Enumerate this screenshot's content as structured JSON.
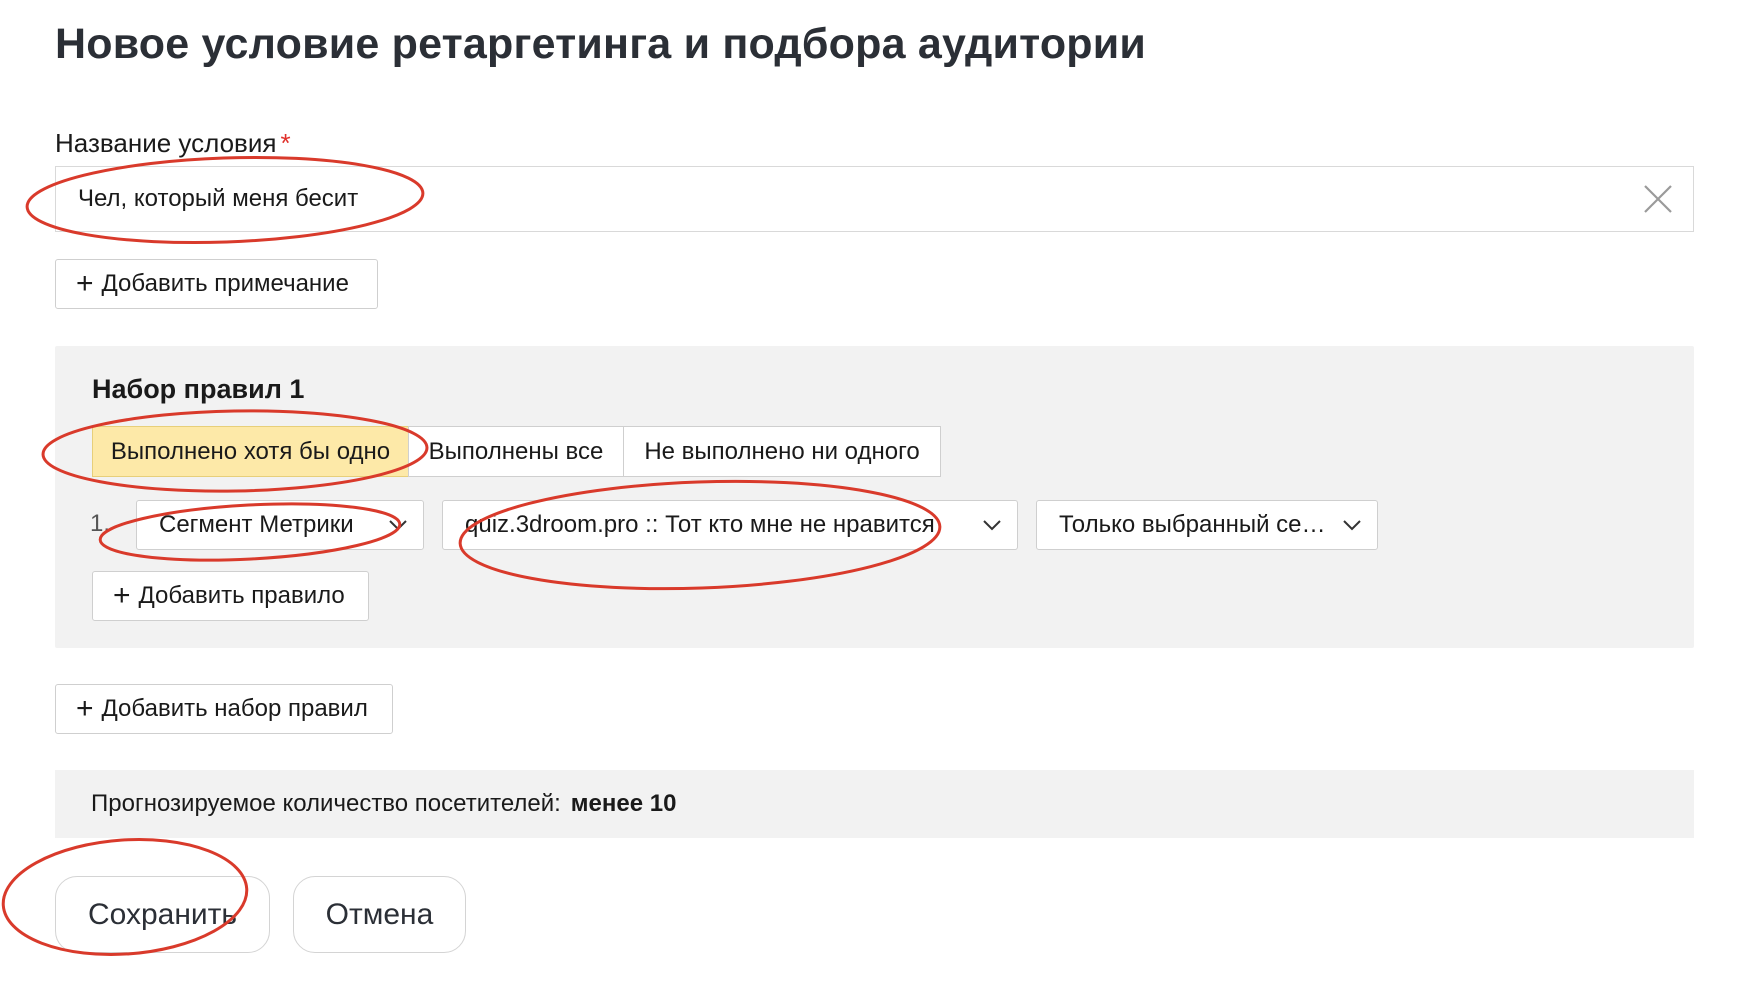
{
  "page": {
    "title": "Новое условие ретаргетинга и подбора аудитории"
  },
  "condition_name": {
    "label": "Название условия",
    "required_mark": "*",
    "value": "Чел, который меня бесит",
    "clear_icon": "close-icon"
  },
  "add_note_button": {
    "icon": "plus-icon",
    "label": "Добавить примечание"
  },
  "ruleset": {
    "title": "Набор правил 1",
    "modes": [
      {
        "label": "Выполнено хотя бы одно",
        "selected": true
      },
      {
        "label": "Выполнены все",
        "selected": false
      },
      {
        "label": "Не выполнено ни одного",
        "selected": false
      }
    ],
    "rule": {
      "number": "1.",
      "type_select": "Сегмент Метрики",
      "segment_select": "quiz.3droom.pro :: Тот кто мне не нравится",
      "scope_select": "Только выбранный сег..."
    },
    "add_rule_button": {
      "icon": "plus-icon",
      "label": "Добавить правило"
    }
  },
  "add_ruleset_button": {
    "icon": "plus-icon",
    "label": "Добавить набор правил"
  },
  "forecast": {
    "label": "Прогнозируемое количество посетителей:",
    "value": "менее 10"
  },
  "actions": {
    "save": "Сохранить",
    "cancel": "Отмена"
  },
  "colors": {
    "selected_segment": "#fde9a8",
    "panel_bg": "#f2f2f2",
    "required": "#e0302a",
    "annotation": "#d93a2b"
  }
}
